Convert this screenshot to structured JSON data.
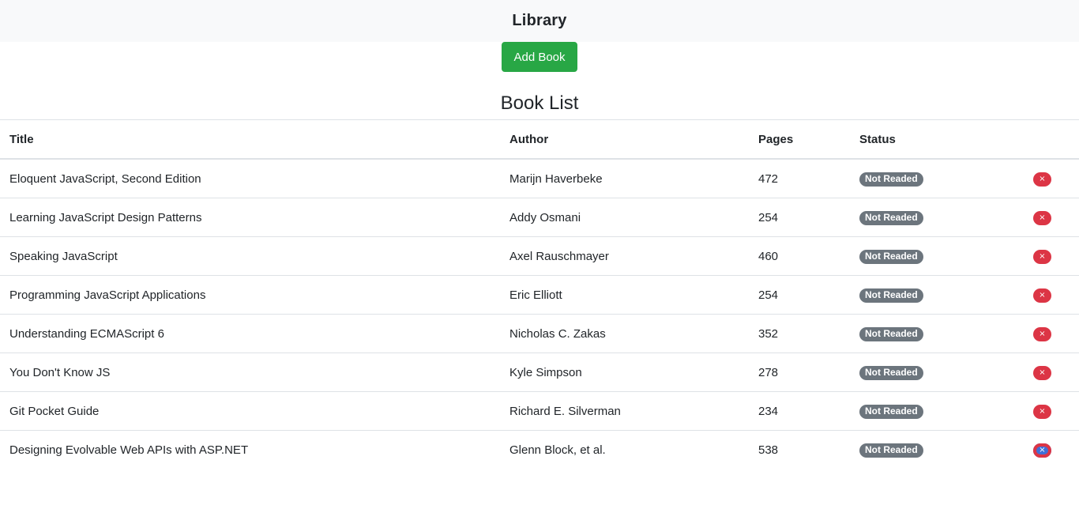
{
  "navbar": {
    "brand": "Library"
  },
  "actions": {
    "add_book_label": "Add Book"
  },
  "book_list": {
    "heading": "Book List",
    "columns": {
      "title": "Title",
      "author": "Author",
      "pages": "Pages",
      "status": "Status"
    },
    "delete_glyph": "×",
    "rows": [
      {
        "title": "Eloquent JavaScript, Second Edition",
        "author": "Marijn Haverbeke",
        "pages": "472",
        "status": "Not Readed"
      },
      {
        "title": "Learning JavaScript Design Patterns",
        "author": "Addy Osmani",
        "pages": "254",
        "status": "Not Readed"
      },
      {
        "title": "Speaking JavaScript",
        "author": "Axel Rauschmayer",
        "pages": "460",
        "status": "Not Readed"
      },
      {
        "title": "Programming JavaScript Applications",
        "author": "Eric Elliott",
        "pages": "254",
        "status": "Not Readed"
      },
      {
        "title": "Understanding ECMAScript 6",
        "author": "Nicholas C. Zakas",
        "pages": "352",
        "status": "Not Readed"
      },
      {
        "title": "You Don't Know JS",
        "author": "Kyle Simpson",
        "pages": "278",
        "status": "Not Readed"
      },
      {
        "title": "Git Pocket Guide",
        "author": "Richard E. Silverman",
        "pages": "234",
        "status": "Not Readed"
      },
      {
        "title": "Designing Evolvable Web APIs with ASP.NET",
        "author": "Glenn Block, et al.",
        "pages": "538",
        "status": "Not Readed"
      }
    ]
  },
  "colors": {
    "navbar_bg": "#f8f9fa",
    "add_button": "#28a745",
    "status_badge": "#6c757d",
    "delete_button": "#dc3545"
  }
}
